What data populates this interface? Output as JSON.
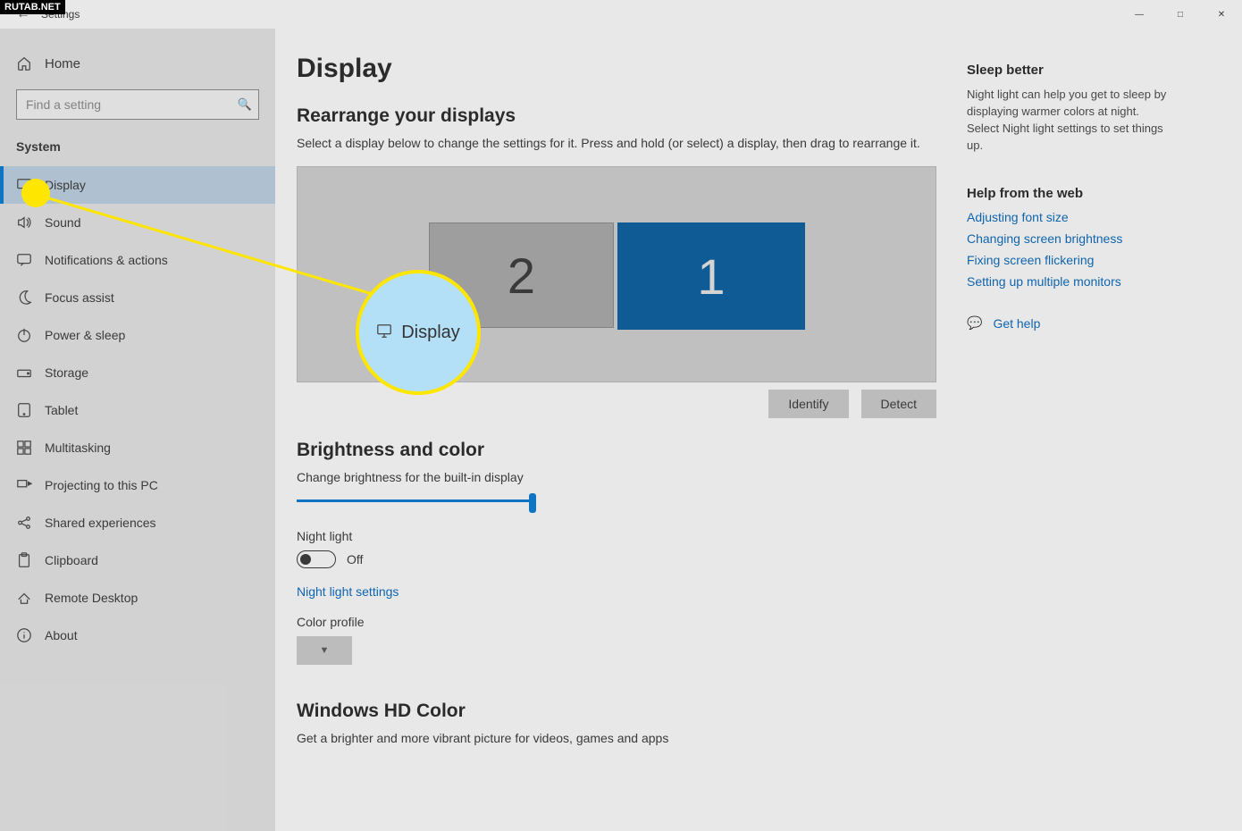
{
  "watermark": "RUTAB.NET",
  "titlebar": {
    "title": "Settings"
  },
  "sidebar": {
    "home_label": "Home",
    "search_placeholder": "Find a setting",
    "section": "System",
    "items": [
      {
        "label": "Display",
        "icon": "monitor-icon",
        "active": true
      },
      {
        "label": "Sound",
        "icon": "speaker-icon"
      },
      {
        "label": "Notifications & actions",
        "icon": "chat-icon"
      },
      {
        "label": "Focus assist",
        "icon": "moon-icon"
      },
      {
        "label": "Power & sleep",
        "icon": "power-icon"
      },
      {
        "label": "Storage",
        "icon": "drive-icon"
      },
      {
        "label": "Tablet",
        "icon": "tablet-icon"
      },
      {
        "label": "Multitasking",
        "icon": "multitask-icon"
      },
      {
        "label": "Projecting to this PC",
        "icon": "project-icon"
      },
      {
        "label": "Shared experiences",
        "icon": "share-icon"
      },
      {
        "label": "Clipboard",
        "icon": "clipboard-icon"
      },
      {
        "label": "Remote Desktop",
        "icon": "remote-icon"
      },
      {
        "label": "About",
        "icon": "info-icon"
      }
    ]
  },
  "page": {
    "title": "Display",
    "rearrange_heading": "Rearrange your displays",
    "rearrange_text": "Select a display below to change the settings for it. Press and hold (or select) a display, then drag to rearrange it.",
    "monitor_1": "1",
    "monitor_2": "2",
    "identify_label": "Identify",
    "detect_label": "Detect",
    "brightness_heading": "Brightness and color",
    "brightness_label": "Change brightness for the built-in display",
    "night_light_label": "Night light",
    "night_light_state": "Off",
    "night_light_settings": "Night light settings",
    "color_profile_label": "Color profile",
    "hdcolor_heading": "Windows HD Color",
    "hdcolor_text": "Get a brighter and more vibrant picture for videos, games and apps"
  },
  "aside": {
    "sleep_heading": "Sleep better",
    "sleep_text": "Night light can help you get to sleep by displaying warmer colors at night. Select Night light settings to set things up.",
    "help_heading": "Help from the web",
    "links": [
      "Adjusting font size",
      "Changing screen brightness",
      "Fixing screen flickering",
      "Setting up multiple monitors"
    ],
    "get_help": "Get help"
  },
  "annotation": {
    "balloon_text": "Display"
  }
}
